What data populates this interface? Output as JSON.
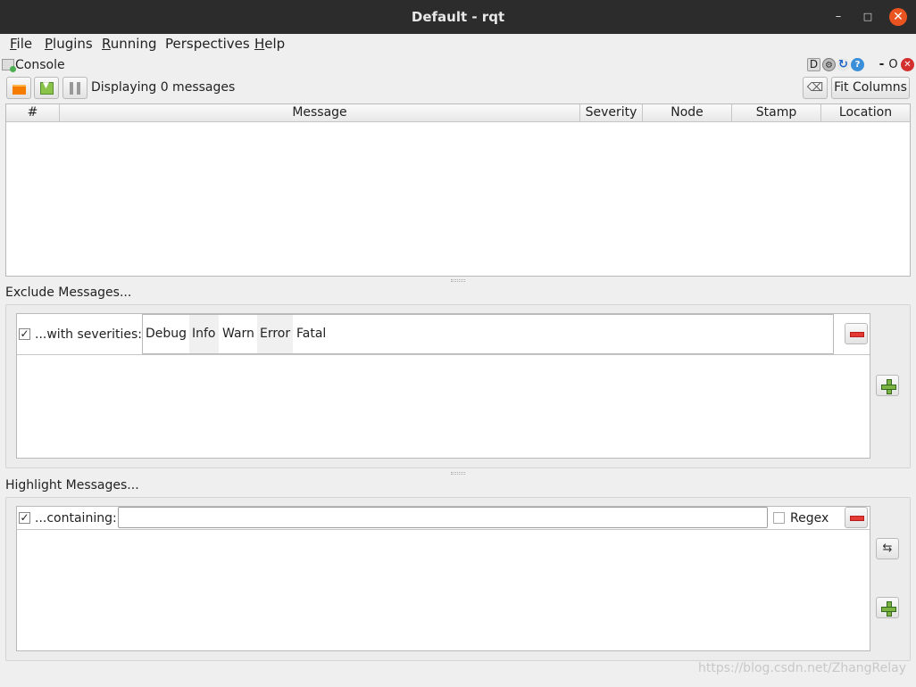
{
  "window": {
    "title": "Default - rqt",
    "minimize_glyph": "–",
    "maximize_glyph": "□",
    "close_glyph": "✕"
  },
  "menu": {
    "items": [
      {
        "label": "File",
        "mnemonic": "F",
        "rest": "ile"
      },
      {
        "label": "Plugins",
        "mnemonic": "P",
        "rest": "lugins"
      },
      {
        "label": "Running",
        "mnemonic": "R",
        "rest": "unning"
      },
      {
        "label": "Perspectives",
        "mnemonic": "P",
        "rest": "erspectives"
      },
      {
        "label": "Help",
        "mnemonic": "H",
        "rest": "elp"
      }
    ]
  },
  "plugin": {
    "title": "Console",
    "d_label": "D",
    "help_glyph": "?",
    "reload_glyph": "↻",
    "gear_glyph": "⚙",
    "dash_label": "-",
    "o_label": "O",
    "close_glyph": "✕"
  },
  "toolbar": {
    "status": "Displaying 0 messages",
    "fit_columns": "Fit Columns",
    "clear_glyph": "⌫"
  },
  "table": {
    "columns": [
      "#",
      "Message",
      "Severity",
      "Node",
      "Stamp",
      "Location"
    ],
    "rows": []
  },
  "exclude": {
    "label": "Exclude Messages...",
    "rule_label": "...with severities:",
    "checked": true,
    "check_glyph": "✓",
    "severities": [
      "Debug",
      "Info",
      "Warn",
      "Error",
      "Fatal"
    ]
  },
  "highlight": {
    "label": "Highlight Messages...",
    "rule_label": "...containing:",
    "checked": true,
    "check_glyph": "✓",
    "input_value": "",
    "regex_label": "Regex",
    "regex_checked": false,
    "swap_glyph": "⇆"
  },
  "watermark": "https://blog.csdn.net/ZhangRelay",
  "colors": {
    "titlebar": "#2c2c2c",
    "close_button": "#e95420",
    "plugin_close": "#d32f2f",
    "help_blue": "#3a8fd8",
    "remove_red": "#e53935",
    "add_green": "#7cb342",
    "open_orange": "#f57c00"
  }
}
